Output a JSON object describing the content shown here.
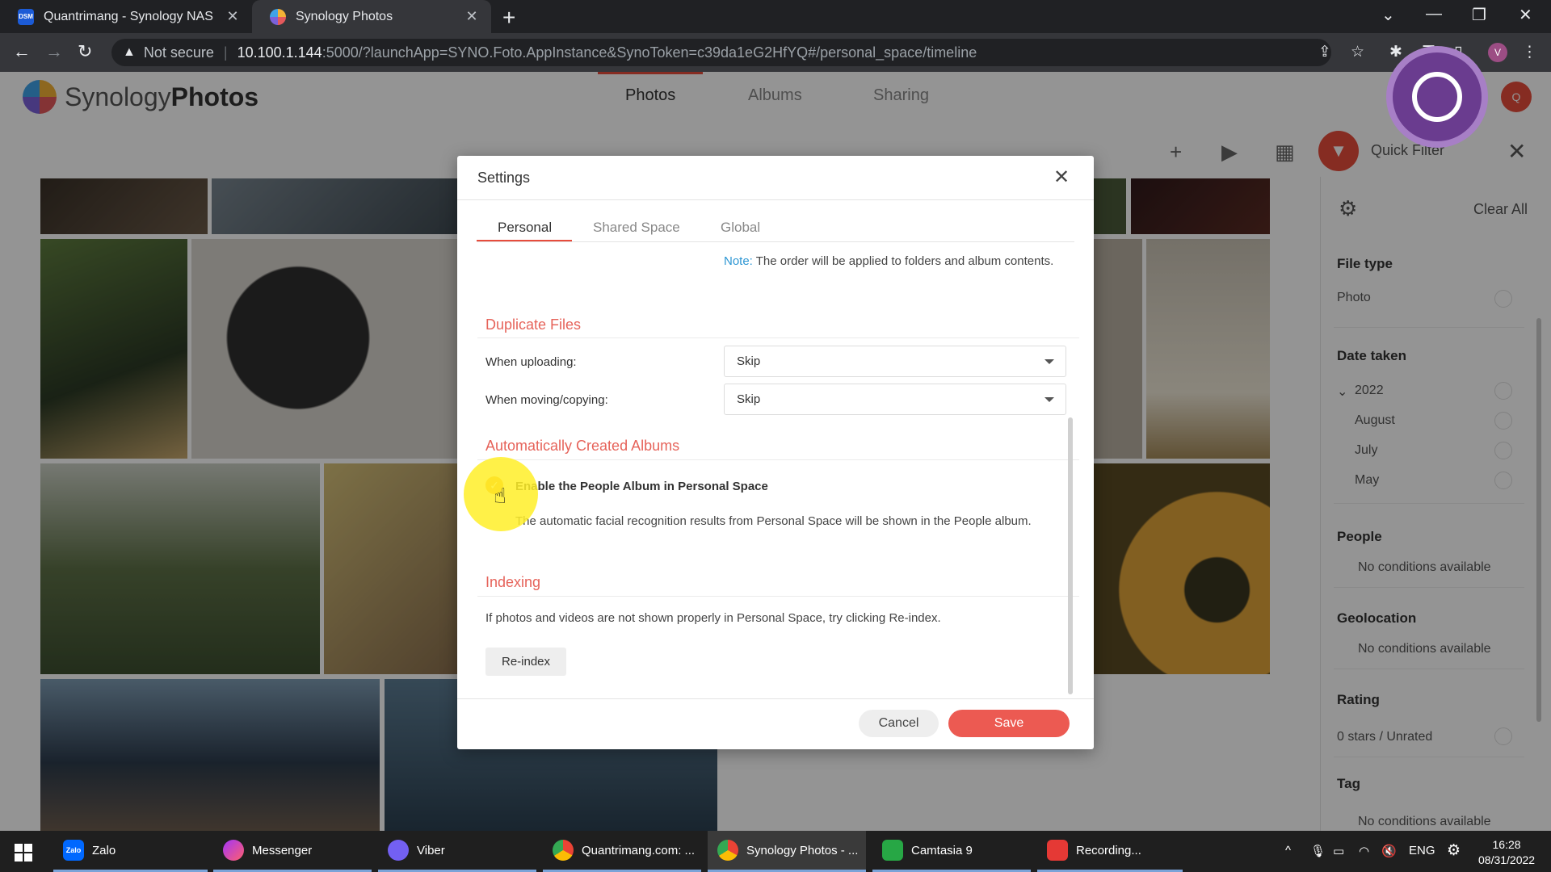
{
  "browser": {
    "tabs": [
      {
        "title": "Quantrimang - Synology NAS",
        "favicon": "DSM"
      },
      {
        "title": "Synology Photos"
      }
    ],
    "address": {
      "security": "Not secure",
      "host": "10.100.1.144",
      "path": ":5000/?launchApp=SYNO.Foto.AppInstance&SynoToken=c39da1eG2HfYQ#/personal_space/timeline"
    },
    "profile_initial": "V"
  },
  "app": {
    "logo_part1": "Synology",
    "logo_part2": "Photos",
    "nav": [
      "Photos",
      "Albums",
      "Sharing"
    ],
    "avatar_initial": "Q",
    "quick_filter_label": "Quick Filter"
  },
  "quick_filter": {
    "clear_all": "Clear All",
    "file_type": {
      "heading": "File type",
      "items": [
        "Photo"
      ]
    },
    "date_taken": {
      "heading": "Date taken",
      "year": "2022",
      "months": [
        "August",
        "July",
        "May"
      ]
    },
    "people": {
      "heading": "People",
      "empty": "No conditions available"
    },
    "geolocation": {
      "heading": "Geolocation",
      "empty": "No conditions available"
    },
    "rating": {
      "heading": "Rating",
      "items": [
        "0 stars / Unrated"
      ]
    },
    "tag": {
      "heading": "Tag",
      "empty": "No conditions available"
    }
  },
  "settings": {
    "title": "Settings",
    "tabs": [
      "Personal",
      "Shared Space",
      "Global"
    ],
    "note_label": "Note:",
    "note_text": " The order will be applied to folders and album contents.",
    "duplicate": {
      "heading": "Duplicate Files",
      "upload_label": "When uploading:",
      "upload_value": "Skip",
      "move_label": "When moving/copying:",
      "move_value": "Skip"
    },
    "albums": {
      "heading": "Automatically Created Albums",
      "checkbox_label": "Enable the People Album in Personal Space",
      "description": "The automatic facial recognition results from Personal Space will be shown in the People album."
    },
    "indexing": {
      "heading": "Indexing",
      "text": "If photos and videos are not shown properly in Personal Space, try clicking Re-index.",
      "button": "Re-index"
    },
    "cancel": "Cancel",
    "save": "Save"
  },
  "taskbar": {
    "apps": [
      "Zalo",
      "Messenger",
      "Viber",
      "Quantrimang.com: ...",
      "Synology Photos - ...",
      "Camtasia 9",
      "Recording..."
    ],
    "zalo_icon_text": "Zalo",
    "language": "ENG",
    "time": "16:28",
    "date": "08/31/2022"
  },
  "colors": {
    "accent": "#e74c3c",
    "section": "#e6635a",
    "note": "#2c96d3",
    "check": "#f5a623"
  }
}
